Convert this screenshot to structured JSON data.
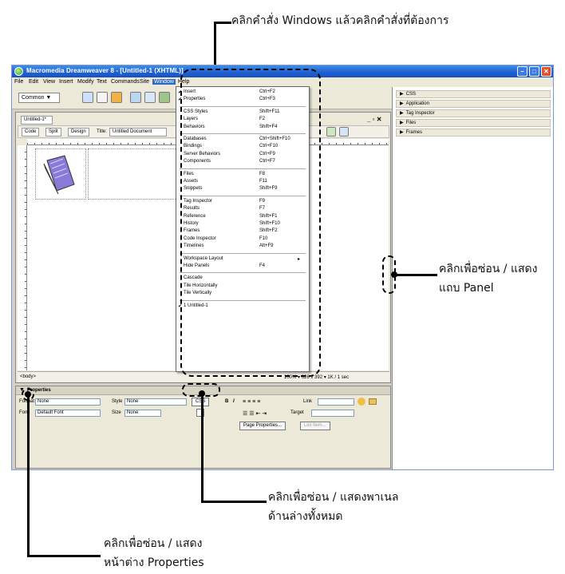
{
  "annotations": {
    "top": "คลิกคำสั่ง Windows แล้วคลิกคำสั่งที่ต้องการ",
    "right_line1": "คลิกเพื่อซ่อน / แสดง",
    "right_line2": "แถบ Panel",
    "middle_line1": "คลิกเพื่อซ่อน / แสดงพาเนล",
    "middle_line2": "ด้านล่างทั้งหมด",
    "bottom_line1": "คลิกเพื่อซ่อน / แสดง",
    "bottom_line2": "หน้าต่าง Properties"
  },
  "window": {
    "title": "Macromedia Dreamweaver 8 - [Untitled-1 (XHTML)]"
  },
  "menubar": [
    "File",
    "Edit",
    "View",
    "Insert",
    "Modify",
    "Text",
    "Commands",
    "Site",
    "Window",
    "Help"
  ],
  "insertbar": {
    "category": "Common"
  },
  "document": {
    "tab": "Untitled-1*",
    "view_code": "Code",
    "view_split": "Split",
    "view_design": "Design",
    "title_label": "Title:",
    "title_value": "Untitled Document",
    "status_tag": "<body>",
    "status_info": "100% ▾ 626 x 392 ▾ 1K / 1 sec"
  },
  "panels": [
    "CSS",
    "Application",
    "Tag Inspector",
    "Files",
    "Frames"
  ],
  "properties": {
    "title": "Properties",
    "format_label": "Format",
    "format_value": "None",
    "style_label": "Style",
    "style_value": "None",
    "css_button": "CSS",
    "bold": "B",
    "italic": "I",
    "link_label": "Link",
    "font_label": "Font",
    "font_value": "Default Font",
    "size_label": "Size",
    "size_value": "None",
    "target_label": "Target",
    "page_properties": "Page Properties...",
    "list_item": "List Item..."
  },
  "window_menu": {
    "groups": [
      [
        {
          "label": "Insert",
          "shortcut": "Ctrl+F2",
          "checked": true
        },
        {
          "label": "Properties",
          "shortcut": "Ctrl+F3",
          "checked": true
        }
      ],
      [
        {
          "label": "CSS Styles",
          "shortcut": "Shift+F11"
        },
        {
          "label": "Layers",
          "shortcut": "F2"
        },
        {
          "label": "Behaviors",
          "shortcut": "Shift+F4"
        }
      ],
      [
        {
          "label": "Databases",
          "shortcut": "Ctrl+Shift+F10"
        },
        {
          "label": "Bindings",
          "shortcut": "Ctrl+F10"
        },
        {
          "label": "Server Behaviors",
          "shortcut": "Ctrl+F9"
        },
        {
          "label": "Components",
          "shortcut": "Ctrl+F7"
        }
      ],
      [
        {
          "label": "Files",
          "shortcut": "F8"
        },
        {
          "label": "Assets",
          "shortcut": "F11"
        },
        {
          "label": "Snippets",
          "shortcut": "Shift+F9"
        }
      ],
      [
        {
          "label": "Tag Inspector",
          "shortcut": "F9"
        },
        {
          "label": "Results",
          "shortcut": "F7"
        },
        {
          "label": "Reference",
          "shortcut": "Shift+F1"
        },
        {
          "label": "History",
          "shortcut": "Shift+F10"
        },
        {
          "label": "Frames",
          "shortcut": "Shift+F2"
        },
        {
          "label": "Code Inspector",
          "shortcut": "F10"
        },
        {
          "label": "Timelines",
          "shortcut": "Alt+F9"
        }
      ],
      [
        {
          "label": "Workspace Layout",
          "shortcut": "▸"
        },
        {
          "label": "Hide Panels",
          "shortcut": "F4"
        }
      ],
      [
        {
          "label": "Cascade",
          "shortcut": ""
        },
        {
          "label": "Tile Horizontally",
          "shortcut": ""
        },
        {
          "label": "Tile Vertically",
          "shortcut": ""
        }
      ],
      [
        {
          "label": "1 Untitled-1",
          "shortcut": "",
          "checked": true
        }
      ]
    ]
  }
}
